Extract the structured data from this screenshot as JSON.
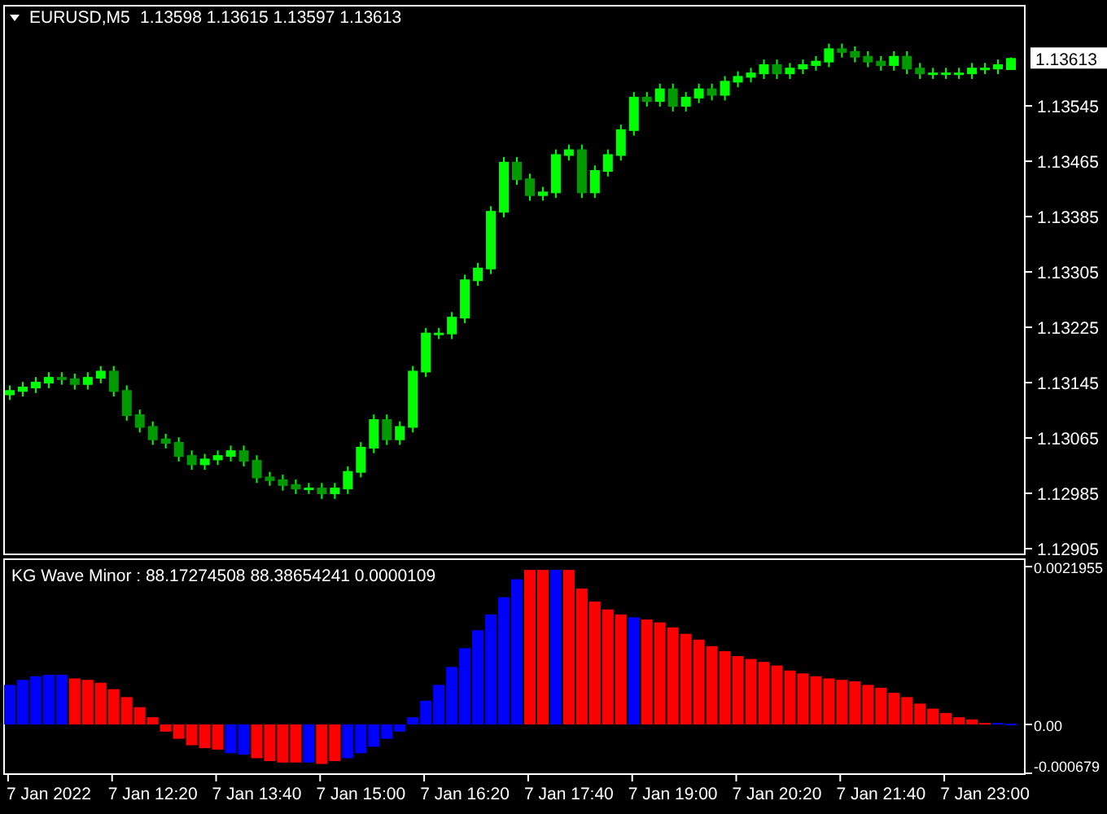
{
  "price_chart": {
    "symbol": "EURUSD,M5",
    "ohlc": "1.13598 1.13615 1.13597 1.13613",
    "current_price": "1.13613",
    "chart_data": {
      "type": "candlestick",
      "ylim": [
        1.12898,
        1.13691
      ],
      "yticks": [
        1.13545,
        1.13465,
        1.13385,
        1.13305,
        1.13225,
        1.13145,
        1.13065,
        1.12985,
        1.12905
      ],
      "categories": [
        null,
        null,
        null,
        null,
        null,
        null,
        null,
        null,
        null,
        null,
        null,
        null,
        null,
        null,
        null,
        null,
        null,
        null,
        null,
        null,
        null,
        null,
        null,
        null,
        null,
        null,
        null,
        null,
        null,
        null,
        null,
        null,
        null,
        null,
        null,
        null,
        null,
        null,
        null,
        null,
        null,
        null,
        null,
        null,
        null,
        null,
        null,
        null,
        null,
        null,
        null,
        null,
        null,
        null,
        null,
        null,
        null,
        null,
        null,
        null,
        null,
        null,
        null,
        null,
        null,
        null,
        null,
        null,
        null,
        null,
        null,
        null,
        null,
        null,
        null,
        null,
        null,
        null
      ],
      "ohlc": [
        [
          1.13128,
          1.13141,
          1.1312,
          1.13133
        ],
        [
          1.13133,
          1.13146,
          1.13125,
          1.13138
        ],
        [
          1.13138,
          1.13153,
          1.1313,
          1.13145
        ],
        [
          1.13145,
          1.1316,
          1.13137,
          1.13152
        ],
        [
          1.13152,
          1.1316,
          1.13142,
          1.1315
        ],
        [
          1.1315,
          1.13158,
          1.13135,
          1.13143
        ],
        [
          1.13143,
          1.1316,
          1.13135,
          1.13152
        ],
        [
          1.13152,
          1.13169,
          1.13144,
          1.13161
        ],
        [
          1.13161,
          1.13169,
          1.13125,
          1.13133
        ],
        [
          1.13133,
          1.13141,
          1.1309,
          1.13098
        ],
        [
          1.13098,
          1.13106,
          1.13073,
          1.13081
        ],
        [
          1.13081,
          1.13089,
          1.13055,
          1.13063
        ],
        [
          1.13063,
          1.13071,
          1.1305,
          1.13058
        ],
        [
          1.13058,
          1.13066,
          1.13031,
          1.13039
        ],
        [
          1.13039,
          1.13047,
          1.13019,
          1.13027
        ],
        [
          1.13027,
          1.13042,
          1.13019,
          1.13034
        ],
        [
          1.13034,
          1.13047,
          1.13026,
          1.13039
        ],
        [
          1.13039,
          1.13054,
          1.13031,
          1.13046
        ],
        [
          1.13046,
          1.13054,
          1.13024,
          1.13032
        ],
        [
          1.13032,
          1.1304,
          1.13,
          1.13008
        ],
        [
          1.13008,
          1.13016,
          1.12996,
          1.13004
        ],
        [
          1.13004,
          1.13012,
          1.12989,
          1.12997
        ],
        [
          1.12997,
          1.13005,
          1.12984,
          1.12992
        ],
        [
          1.12992,
          1.13,
          1.12984,
          1.12992
        ],
        [
          1.12992,
          1.13,
          1.12977,
          1.12985
        ],
        [
          1.12985,
          1.13,
          1.12977,
          1.12992
        ],
        [
          1.12992,
          1.13024,
          1.12984,
          1.13016
        ],
        [
          1.13016,
          1.13059,
          1.13008,
          1.13051
        ],
        [
          1.13051,
          1.13099,
          1.13043,
          1.13091
        ],
        [
          1.13091,
          1.13099,
          1.13055,
          1.13063
        ],
        [
          1.13063,
          1.13089,
          1.13055,
          1.13081
        ],
        [
          1.13081,
          1.13169,
          1.13073,
          1.13161
        ],
        [
          1.13161,
          1.13224,
          1.13153,
          1.13216
        ],
        [
          1.13216,
          1.13224,
          1.13208,
          1.13216
        ],
        [
          1.13216,
          1.13247,
          1.13208,
          1.13239
        ],
        [
          1.13239,
          1.13301,
          1.13231,
          1.13293
        ],
        [
          1.13293,
          1.13318,
          1.13285,
          1.1331
        ],
        [
          1.1331,
          1.134,
          1.13302,
          1.13392
        ],
        [
          1.13392,
          1.13471,
          1.13384,
          1.13463
        ],
        [
          1.13463,
          1.13471,
          1.13431,
          1.13439
        ],
        [
          1.13439,
          1.13447,
          1.13408,
          1.13416
        ],
        [
          1.13416,
          1.13428,
          1.13408,
          1.1342
        ],
        [
          1.1342,
          1.13482,
          1.13412,
          1.13474
        ],
        [
          1.13474,
          1.13489,
          1.13466,
          1.13481
        ],
        [
          1.13481,
          1.13489,
          1.13412,
          1.1342
        ],
        [
          1.1342,
          1.13459,
          1.13412,
          1.13451
        ],
        [
          1.13451,
          1.13482,
          1.13443,
          1.13474
        ],
        [
          1.13474,
          1.13518,
          1.13466,
          1.1351
        ],
        [
          1.1351,
          1.13565,
          1.13502,
          1.13557
        ],
        [
          1.13557,
          1.13565,
          1.13544,
          1.13552
        ],
        [
          1.13552,
          1.13577,
          1.13544,
          1.13569
        ],
        [
          1.13569,
          1.13577,
          1.13537,
          1.13545
        ],
        [
          1.13545,
          1.13565,
          1.13537,
          1.13557
        ],
        [
          1.13557,
          1.13577,
          1.13549,
          1.13569
        ],
        [
          1.13569,
          1.13577,
          1.13553,
          1.13561
        ],
        [
          1.13561,
          1.13588,
          1.13553,
          1.1358
        ],
        [
          1.1358,
          1.13595,
          1.13572,
          1.13587
        ],
        [
          1.13587,
          1.136,
          1.13579,
          1.13592
        ],
        [
          1.13592,
          1.13612,
          1.13584,
          1.13604
        ],
        [
          1.13604,
          1.13612,
          1.13584,
          1.13592
        ],
        [
          1.13592,
          1.13607,
          1.13584,
          1.13599
        ],
        [
          1.13599,
          1.13612,
          1.13591,
          1.13604
        ],
        [
          1.13604,
          1.13617,
          1.13596,
          1.13609
        ],
        [
          1.13609,
          1.13635,
          1.13601,
          1.13627
        ],
        [
          1.13627,
          1.13635,
          1.13615,
          1.13623
        ],
        [
          1.13623,
          1.13631,
          1.13608,
          1.13616
        ],
        [
          1.13616,
          1.13624,
          1.13601,
          1.13609
        ],
        [
          1.13609,
          1.13617,
          1.13596,
          1.13604
        ],
        [
          1.13604,
          1.13624,
          1.13596,
          1.13616
        ],
        [
          1.13616,
          1.13624,
          1.13591,
          1.13599
        ],
        [
          1.13599,
          1.13607,
          1.13584,
          1.13592
        ],
        [
          1.13592,
          1.136,
          1.13584,
          1.13592
        ],
        [
          1.13592,
          1.136,
          1.13584,
          1.13592
        ],
        [
          1.13592,
          1.136,
          1.13584,
          1.13592
        ],
        [
          1.13592,
          1.13607,
          1.13584,
          1.13599
        ],
        [
          1.13599,
          1.13607,
          1.13591,
          1.13599
        ],
        [
          1.13599,
          1.13612,
          1.13591,
          1.13604
        ],
        [
          1.13598,
          1.13615,
          1.13597,
          1.13613
        ]
      ]
    }
  },
  "indicator": {
    "label": "KG Wave Minor : 88.17274508 88.38654241 0.0000109",
    "chart_data": {
      "type": "bar",
      "ylim": [
        -0.00068,
        0.00231
      ],
      "categories": [
        null,
        null,
        null,
        "7 Jan 2022",
        null,
        null,
        null,
        null,
        null,
        null,
        null,
        "7 Jan 12:20",
        null,
        null,
        null,
        null,
        null,
        null,
        null,
        "7 Jan 13:40",
        null,
        null,
        null,
        null,
        null,
        null,
        null,
        "7 Jan 15:00",
        null,
        null,
        null,
        null,
        null,
        null,
        null,
        "7 Jan 16:20",
        null,
        null,
        null,
        null,
        null,
        null,
        null,
        "7 Jan 17:40",
        null,
        null,
        null,
        null,
        null,
        null,
        null,
        "7 Jan 19:00",
        null,
        null,
        null,
        null,
        null,
        null,
        null,
        "7 Jan 20:20",
        null,
        null,
        null,
        null,
        null,
        null,
        null,
        "7 Jan 21:40",
        null,
        null,
        null,
        null,
        null,
        null,
        null,
        "7 Jan 23:00",
        null,
        null
      ],
      "yticks": [
        {
          "value": 0.0021955,
          "label": "0.0021955"
        },
        {
          "value": 0,
          "label": "0.00"
        },
        {
          "value": -0.0006795,
          "label": "-0.000679"
        }
      ],
      "series": [
        {
          "color": "#0000ff",
          "values": [
            0.00055,
            0.00062,
            0.00067,
            0.00069,
            0.00069,
            null,
            null,
            null,
            null,
            null,
            null,
            null,
            null,
            null,
            null,
            null,
            null,
            -0.0004,
            -0.00042,
            null,
            null,
            null,
            null,
            -0.00053,
            null,
            null,
            -0.00047,
            -0.0004,
            -0.00031,
            -0.0002,
            -0.0001,
            0.0001,
            0.00033,
            0.00055,
            0.0008,
            0.00106,
            0.00131,
            0.00153,
            0.00177,
            0.00202,
            null,
            null,
            0.00215,
            null,
            null,
            null,
            null,
            null,
            0.00149,
            null,
            null,
            null,
            null,
            null,
            null,
            null,
            null,
            null,
            null,
            null,
            null,
            null,
            null,
            null,
            null,
            null,
            null,
            null,
            null,
            null,
            null,
            null,
            null,
            null,
            null,
            null,
            2e-05,
            1e-05
          ]
        },
        {
          "color": "#ff0000",
          "values": [
            null,
            null,
            null,
            null,
            null,
            0.00064,
            0.00062,
            0.00058,
            0.00049,
            0.00038,
            0.00024,
            0.0001,
            -0.0001,
            -0.0002,
            -0.00029,
            -0.00033,
            -0.00035,
            null,
            null,
            -0.00047,
            -0.00051,
            -0.00053,
            -0.00053,
            null,
            -0.00055,
            -0.00051,
            null,
            null,
            null,
            null,
            null,
            null,
            null,
            null,
            null,
            null,
            null,
            null,
            null,
            null,
            0.00215,
            0.00215,
            null,
            0.00215,
            0.00189,
            0.00171,
            0.0016,
            0.00153,
            null,
            0.00146,
            0.00142,
            0.00135,
            0.00126,
            0.00118,
            0.00109,
            0.00102,
            0.00095,
            0.00091,
            0.00087,
            0.00082,
            0.00075,
            0.00071,
            0.00067,
            0.00064,
            0.00062,
            0.0006,
            0.00055,
            0.00051,
            0.00044,
            0.00038,
            0.00029,
            0.00022,
            0.00016,
            0.0001,
            7e-05,
            2e-05,
            null,
            null
          ]
        }
      ]
    }
  }
}
